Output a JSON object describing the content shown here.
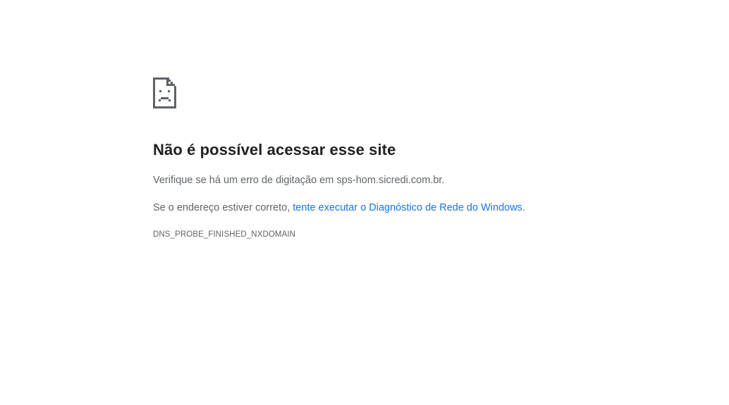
{
  "error": {
    "icon": "sad-page-icon",
    "title": "Não é possível acessar esse site",
    "hint_prefix": "Verifique se há um erro de digitação em ",
    "domain": "sps-hom.sicredi.com.br",
    "hint_suffix": ".",
    "suggestion_prefix": "Se o endereço estiver correto, ",
    "suggestion_link": "tente executar o Diagnóstico de Rede do Windows",
    "suggestion_suffix": ".",
    "error_code": "DNS_PROBE_FINISHED_NXDOMAIN"
  },
  "colors": {
    "text": "#5f6368",
    "heading": "#202124",
    "link": "#1a73e8",
    "icon": "#5f6368"
  }
}
